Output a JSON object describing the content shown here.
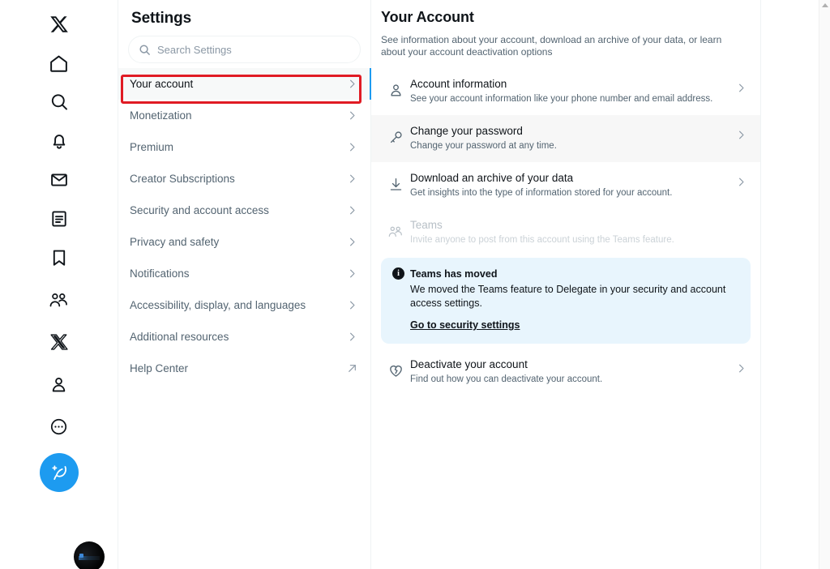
{
  "nav": {
    "items": [
      {
        "icon": "x-logo-icon",
        "name": "nav-home-logo"
      },
      {
        "icon": "home-icon",
        "name": "nav-home"
      },
      {
        "icon": "search-icon",
        "name": "nav-explore"
      },
      {
        "icon": "bell-icon",
        "name": "nav-notifications"
      },
      {
        "icon": "mail-icon",
        "name": "nav-messages"
      },
      {
        "icon": "list-icon",
        "name": "nav-lists"
      },
      {
        "icon": "bookmark-icon",
        "name": "nav-bookmarks"
      },
      {
        "icon": "communities-icon",
        "name": "nav-communities"
      },
      {
        "icon": "x-premium-icon",
        "name": "nav-premium"
      },
      {
        "icon": "person-icon",
        "name": "nav-profile"
      },
      {
        "icon": "more-circle-icon",
        "name": "nav-more"
      }
    ],
    "compose_icon": "compose-quill-icon",
    "avatar_label": "account-avatar"
  },
  "settings": {
    "title": "Settings",
    "search": {
      "placeholder": "Search Settings",
      "value": "",
      "icon": "search-icon"
    },
    "items": [
      {
        "label": "Your account",
        "chevron": "chevron-right-icon",
        "selected": true
      },
      {
        "label": "Monetization",
        "chevron": "chevron-right-icon",
        "selected": false
      },
      {
        "label": "Premium",
        "chevron": "chevron-right-icon",
        "selected": false
      },
      {
        "label": "Creator Subscriptions",
        "chevron": "chevron-right-icon",
        "selected": false
      },
      {
        "label": "Security and account access",
        "chevron": "chevron-right-icon",
        "selected": false
      },
      {
        "label": "Privacy and safety",
        "chevron": "chevron-right-icon",
        "selected": false
      },
      {
        "label": "Notifications",
        "chevron": "chevron-right-icon",
        "selected": false
      },
      {
        "label": "Accessibility, display, and languages",
        "chevron": "chevron-right-icon",
        "selected": false
      },
      {
        "label": "Additional resources",
        "chevron": "chevron-right-icon",
        "selected": false
      },
      {
        "label": "Help Center",
        "chevron": "external-link-icon",
        "selected": false
      }
    ]
  },
  "detail": {
    "title": "Your Account",
    "description": "See information about your account, download an archive of your data, or learn about your account deactivation options",
    "rows": [
      {
        "icon": "person-icon",
        "title": "Account information",
        "subtitle": "See your account information like your phone number and email address.",
        "disabled": false,
        "hovered": false,
        "has_chevron": true
      },
      {
        "icon": "key-icon",
        "title": "Change your password",
        "subtitle": "Change your password at any time.",
        "disabled": false,
        "hovered": true,
        "has_chevron": true
      },
      {
        "icon": "download-icon",
        "title": "Download an archive of your data",
        "subtitle": "Get insights into the type of information stored for your account.",
        "disabled": false,
        "hovered": false,
        "has_chevron": true
      },
      {
        "icon": "teams-people-icon",
        "title": "Teams",
        "subtitle": "Invite anyone to post from this account using the Teams feature.",
        "disabled": true,
        "hovered": false,
        "has_chevron": false
      }
    ],
    "callout": {
      "icon": "info-icon",
      "title": "Teams has moved",
      "body": "We moved the Teams feature to Delegate in your security and account access settings.",
      "link": "Go to security settings"
    },
    "deactivate_row": {
      "icon": "broken-heart-icon",
      "title": "Deactivate your account",
      "subtitle": "Find out how you can deactivate your account.",
      "has_chevron": true
    }
  },
  "colors": {
    "accent": "#1d9bf0",
    "highlight_box": "#e01b24",
    "callout_bg": "#e8f5fd",
    "text_primary": "#0f1419",
    "text_secondary": "#536471",
    "hover_bg": "#f7f7f7"
  }
}
